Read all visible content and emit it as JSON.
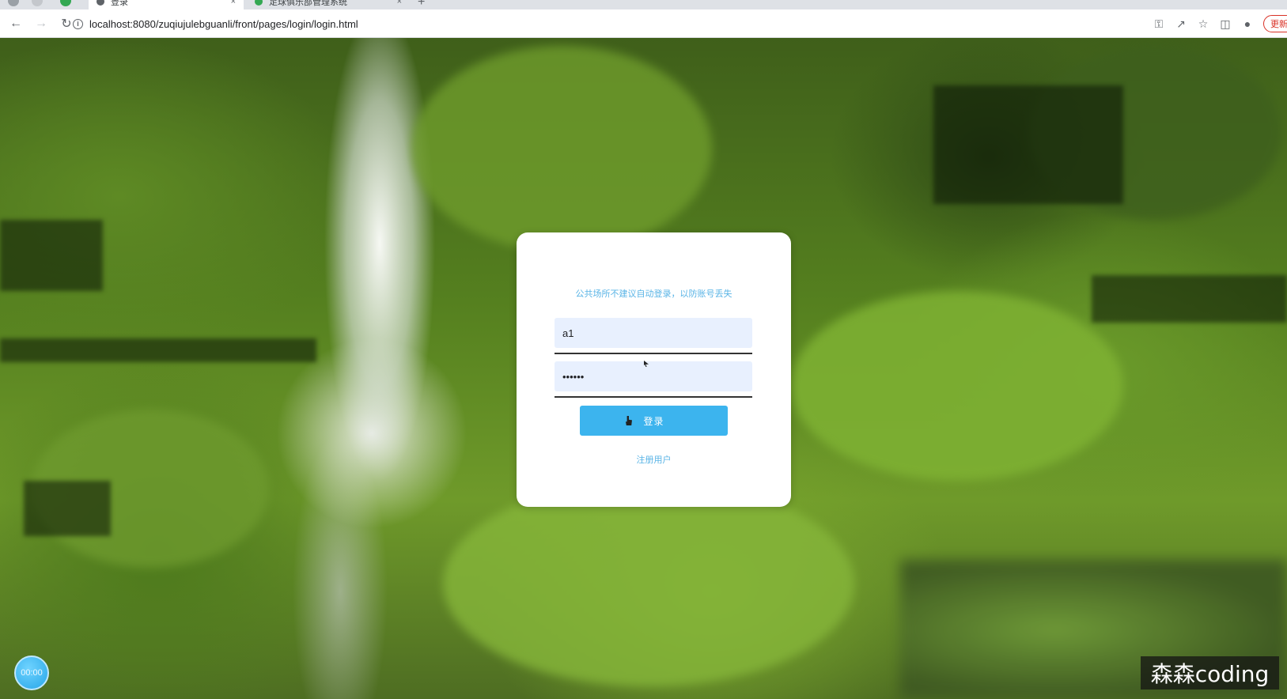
{
  "browser": {
    "tabs": [
      {
        "label": "登录",
        "active": true
      },
      {
        "label": "足球俱乐部管理系统",
        "active": false
      }
    ],
    "new_tab_glyph": "+",
    "close_glyph": "×",
    "url": "localhost:8080/zuqiujulebguanli/front/pages/login/login.html",
    "update_label": "更新",
    "icons": [
      "back-icon",
      "forward-icon",
      "reload-icon",
      "info-icon",
      "key-icon",
      "share-icon",
      "star-icon",
      "sidepanel-icon",
      "profile-icon"
    ]
  },
  "login": {
    "notice": "公共场所不建议自动登录，以防账号丢失",
    "username_value": "a1",
    "password_value": "••••••",
    "login_button": "登录",
    "register_link": "注册用户"
  },
  "overlay": {
    "timer": "00:00",
    "watermark": "森森coding"
  },
  "colors": {
    "accent": "#3cb4ee",
    "link": "#5ab4e6",
    "input_bg": "#e8f0fe"
  }
}
